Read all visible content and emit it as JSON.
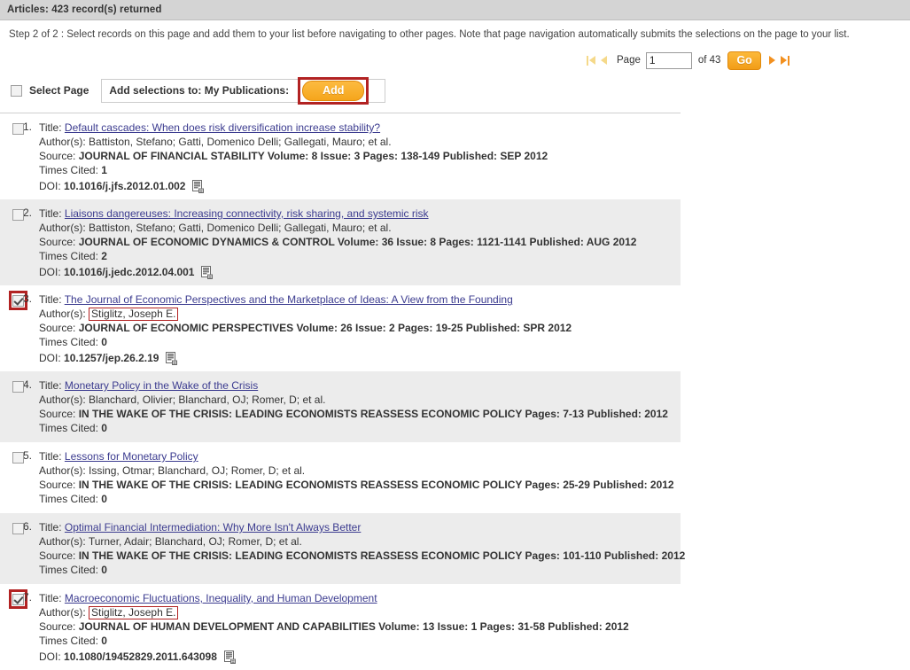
{
  "titlebar": {
    "text": "Articles: 423 record(s) returned"
  },
  "step": {
    "text": "Step 2 of 2 : Select records on this page and add them to your list before navigating to other pages. Note that page navigation automatically submits the selections on the page to your list."
  },
  "pager": {
    "first_icon": "first-page-icon",
    "prev_icon": "previous-page-icon",
    "page_label": "Page",
    "page_value": "1",
    "of_label": "of 43",
    "go_label": "Go",
    "next_icon": "next-page-icon",
    "last_icon": "last-page-icon",
    "disabled_color": "#f5d98a",
    "active_color": "#f2901f"
  },
  "select_bar": {
    "select_page_label": "Select Page",
    "add_to_label": "Add selections to: My Publications:",
    "add_button_label": "Add",
    "highlight_color": "#b22222"
  },
  "labels": {
    "title": "Title:",
    "authors": "Author(s):",
    "source": "Source:",
    "times_cited": "Times Cited:",
    "doi": "DOI:"
  },
  "records": [
    {
      "num": "1.",
      "checked": false,
      "highlight_checkbox": false,
      "title": "Default cascades: When does risk diversification increase stability?",
      "authors": "Battiston, Stefano; Gatti, Domenico Delli; Gallegati, Mauro; et al.",
      "author_highlight": false,
      "source": "JOURNAL OF FINANCIAL STABILITY Volume: 8 Issue: 3 Pages: 138-149 Published: SEP 2012",
      "times_cited": "1",
      "doi": "10.1016/j.jfs.2012.01.002",
      "has_doi": true,
      "alt": false
    },
    {
      "num": "2.",
      "checked": false,
      "highlight_checkbox": false,
      "title": "Liaisons dangereuses: Increasing connectivity, risk sharing, and systemic risk",
      "authors": "Battiston, Stefano; Gatti, Domenico Delli; Gallegati, Mauro; et al.",
      "author_highlight": false,
      "source": "JOURNAL OF ECONOMIC DYNAMICS & CONTROL Volume: 36 Issue: 8 Pages: 1121-1141 Published: AUG 2012",
      "times_cited": "2",
      "doi": "10.1016/j.jedc.2012.04.001",
      "has_doi": true,
      "alt": true
    },
    {
      "num": "3.",
      "checked": true,
      "highlight_checkbox": true,
      "title": "The Journal of Economic Perspectives and the Marketplace of Ideas: A View from the Founding",
      "authors": "Stiglitz, Joseph E.",
      "author_highlight": true,
      "source": "JOURNAL OF ECONOMIC PERSPECTIVES Volume: 26 Issue: 2 Pages: 19-25 Published: SPR 2012",
      "times_cited": "0",
      "doi": "10.1257/jep.26.2.19",
      "has_doi": true,
      "alt": false
    },
    {
      "num": "4.",
      "checked": false,
      "highlight_checkbox": false,
      "title": "Monetary Policy in the Wake of the Crisis",
      "authors": "Blanchard, Olivier; Blanchard, OJ; Romer, D; et al.",
      "author_highlight": false,
      "source": "IN THE WAKE OF THE CRISIS: LEADING ECONOMISTS REASSESS ECONOMIC POLICY Pages: 7-13 Published: 2012",
      "times_cited": "0",
      "doi": "",
      "has_doi": false,
      "alt": true
    },
    {
      "num": "5.",
      "checked": false,
      "highlight_checkbox": false,
      "title": "Lessons for Monetary Policy",
      "authors": "Issing, Otmar; Blanchard, OJ; Romer, D; et al.",
      "author_highlight": false,
      "source": "IN THE WAKE OF THE CRISIS: LEADING ECONOMISTS REASSESS ECONOMIC POLICY Pages: 25-29 Published: 2012",
      "times_cited": "0",
      "doi": "",
      "has_doi": false,
      "alt": false
    },
    {
      "num": "6.",
      "checked": false,
      "highlight_checkbox": false,
      "title": "Optimal Financial Intermediation: Why More Isn't Always Better",
      "authors": "Turner, Adair; Blanchard, OJ; Romer, D; et al.",
      "author_highlight": false,
      "source": "IN THE WAKE OF THE CRISIS: LEADING ECONOMISTS REASSESS ECONOMIC POLICY Pages: 101-110 Published: 2012",
      "times_cited": "0",
      "doi": "",
      "has_doi": false,
      "alt": true
    },
    {
      "num": "7.",
      "checked": true,
      "highlight_checkbox": true,
      "title": "Macroeconomic Fluctuations, Inequality, and Human Development",
      "authors": "Stiglitz, Joseph E.",
      "author_highlight": true,
      "source": "JOURNAL OF HUMAN DEVELOPMENT AND CAPABILITIES Volume: 13 Issue: 1 Pages: 31-58 Published: 2012",
      "times_cited": "0",
      "doi": "10.1080/19452829.2011.643098",
      "has_doi": true,
      "alt": false
    }
  ]
}
